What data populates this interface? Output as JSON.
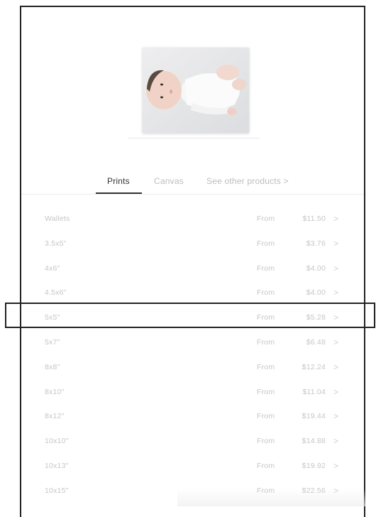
{
  "product_image": {
    "alt": "baby-photo",
    "icon": "baby-photo-image"
  },
  "tabs": [
    {
      "label": "Prints",
      "active": true
    },
    {
      "label": "Canvas",
      "active": false
    },
    {
      "label": "See other products  >",
      "active": false
    }
  ],
  "rows": [
    {
      "size": "Wallets",
      "from": "From",
      "price": "$11.50"
    },
    {
      "size": "3.5x5\"",
      "from": "From",
      "price": "$3.76"
    },
    {
      "size": "4x6\"",
      "from": "From",
      "price": "$4.00"
    },
    {
      "size": "4.5x6\"",
      "from": "From",
      "price": "$4.00"
    },
    {
      "size": "5x5\"",
      "from": "From",
      "price": "$5.28"
    },
    {
      "size": "5x7\"",
      "from": "From",
      "price": "$6.48"
    },
    {
      "size": "8x8\"",
      "from": "From",
      "price": "$12.24"
    },
    {
      "size": "8x10\"",
      "from": "From",
      "price": "$11.04"
    },
    {
      "size": "8x12\"",
      "from": "From",
      "price": "$19.44"
    },
    {
      "size": "10x10\"",
      "from": "From",
      "price": "$14.88"
    },
    {
      "size": "10x13\"",
      "from": "From",
      "price": "$19.92"
    },
    {
      "size": "10x15\"",
      "from": "From",
      "price": "$22.56"
    }
  ],
  "chevron": ">",
  "colors": {
    "active_tab": "#333333",
    "inactive_text": "#c6c6c6",
    "highlight_border": "#222222"
  }
}
